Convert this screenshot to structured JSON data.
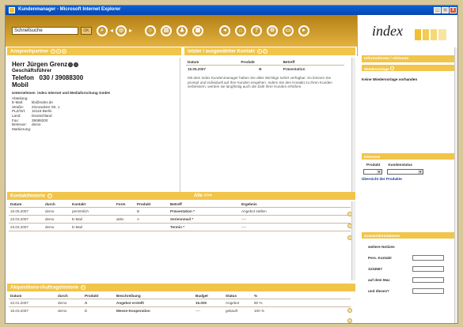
{
  "window": {
    "title": "Kundenmanager - Microsoft Internet Explorer",
    "controls": [
      "_",
      "□",
      "X"
    ]
  },
  "toolbar": {
    "search_value": "Schnellsuche",
    "go_label": "OK"
  },
  "logo": {
    "text": "index"
  },
  "contact": {
    "header": "Ansprechpartner",
    "name": "Herr Jürgen Grenz",
    "role": "Geschäftsführer",
    "phone_label": "Telefon",
    "phone": "030 / 39088300",
    "mobile_label": "Mobil",
    "company_label": "Unternehmen",
    "company": "index Internet und Mediaforschung GmbH",
    "fields": [
      {
        "k": "Abteilung:",
        "v": ""
      },
      {
        "k": "E-Mail:",
        "v": "kb@index.de"
      },
      {
        "k": "Straße:",
        "v": "Zinnowitzer Str. 1"
      },
      {
        "k": "PLZ/Ort:",
        "v": "10115 Berlin"
      },
      {
        "k": "Land:",
        "v": "Deutschland"
      },
      {
        "k": "Fax:",
        "v": "39088200"
      },
      {
        "k": "Betreuer:",
        "v": "demo"
      },
      {
        "k": "Markierung:",
        "v": ""
      }
    ]
  },
  "last_contact": {
    "header": "letzter / ausgewählter Kontakt",
    "cols": [
      "Datum",
      "Produkt",
      "Betreff"
    ],
    "row": [
      "15.05.2007",
      "B",
      "Präsentation"
    ],
    "text": "Mit dem index Kundenmanager haben Sie alles Wichtige sofort verfügbar. So können Sie prompt und individuell auf Ihre Kunden eingehen. Indem Sie den Kontakt zu Ihren Kunden verbessern, werden sie langfristig auch die Zahl Ihrer Kunden erhöhen."
  },
  "history": {
    "header": "Kontakthistorie",
    "all_label": "Alle >>>",
    "cols": [
      "Datum",
      "durch",
      "Kontakt",
      "Form",
      "Produkt",
      "Betreff",
      "Ergebnis"
    ],
    "rows": [
      [
        "15.05.2007",
        "demo",
        "persönlich",
        "",
        "B",
        "Präsentation *",
        "Angebot stellen"
      ],
      [
        "23.03.2007",
        "demo",
        "E-Mail",
        "aktiv",
        "A",
        "Seriennmail *",
        "----"
      ],
      [
        "23.02.2007",
        "demo",
        "E-Mail",
        "",
        "",
        "Termin *",
        "----"
      ]
    ]
  },
  "acquisition": {
    "header": "Akquisitions-/Auftragshistorie",
    "cols": [
      "Datum",
      "durch",
      "Produkt",
      "Beschreibung",
      "Budget",
      "Status",
      "%"
    ],
    "rows": [
      [
        "22.01.2007",
        "demo",
        "A",
        "Angebot erstellt",
        "15.000",
        "Angebot",
        "80 %"
      ],
      [
        "15.03.2007",
        "demo",
        "C",
        "Messe-Kooperation",
        "----",
        "gekauft",
        "100 %"
      ]
    ]
  },
  "sidebar": {
    "header": "Informationen / Aktionen",
    "resubmission_title": "Wiedervorlage",
    "resubmission_text": "Keine Wiedervorlage vorhanden",
    "interests_title": "Interesse",
    "interests_cols": [
      "Produkt",
      "Kundenstatus"
    ],
    "interests_link": "Übersicht der Produkte",
    "extra_title": "Zusatzinformationen",
    "extra_fields": [
      "weitere Notizen",
      "Pers. Kontakt",
      "1234567",
      "auf dem Mac",
      "und dieses?"
    ]
  },
  "colors": {
    "accent": "#f1c44a",
    "toolbar": "#d2a02c"
  }
}
